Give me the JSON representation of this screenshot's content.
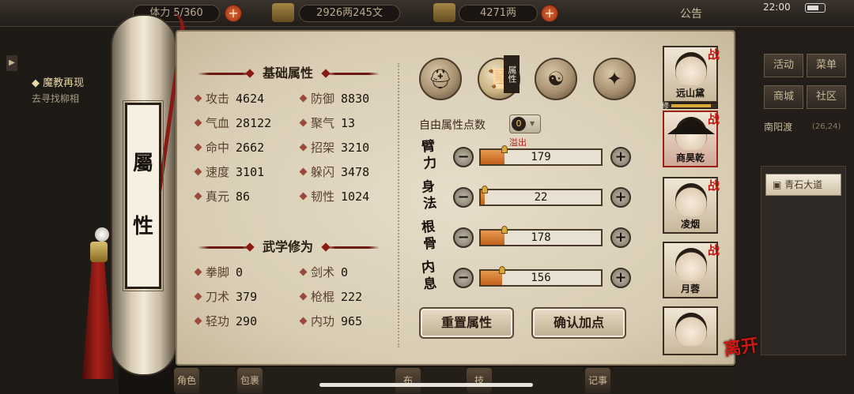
{
  "topbar": {
    "stamina": "5/360",
    "stamina_label": "体力",
    "silver": "2926两245文",
    "gold": "4271两",
    "announcement": "公告",
    "time": "22:00"
  },
  "quest": {
    "title": "魔教再现",
    "subtitle": "去寻找柳相"
  },
  "scroll": {
    "label_top": "屬",
    "label_bottom": "性"
  },
  "basic": {
    "title": "基础属性",
    "stats": [
      {
        "name": "攻击",
        "value": "4624"
      },
      {
        "name": "防御",
        "value": "8830"
      },
      {
        "name": "气血",
        "value": "28122"
      },
      {
        "name": "聚气",
        "value": "13"
      },
      {
        "name": "命中",
        "value": "2662"
      },
      {
        "name": "招架",
        "value": "3210"
      },
      {
        "name": "速度",
        "value": "3101"
      },
      {
        "name": "躲闪",
        "value": "3478"
      },
      {
        "name": "真元",
        "value": "86"
      },
      {
        "name": "韧性",
        "value": "1024"
      }
    ]
  },
  "martial": {
    "title": "武学修为",
    "stats": [
      {
        "name": "拳脚",
        "value": "0"
      },
      {
        "name": "剑术",
        "value": "0"
      },
      {
        "name": "刀术",
        "value": "379"
      },
      {
        "name": "枪棍",
        "value": "222"
      },
      {
        "name": "轻功",
        "value": "290"
      },
      {
        "name": "内功",
        "value": "965"
      }
    ]
  },
  "tabs": {
    "badge": "属性",
    "icons": [
      "hat-character-icon",
      "scroll-attributes-icon",
      "bagua-icon",
      "meridian-figure-icon"
    ]
  },
  "allocation": {
    "free_label": "自由属性点数",
    "free_points": "0",
    "overflow_label": "溢出",
    "attributes": [
      {
        "name_top": "臂",
        "name_bottom": "力",
        "value": "179",
        "fill": 0.2
      },
      {
        "name_top": "身",
        "name_bottom": "法",
        "value": "22",
        "fill": 0.03
      },
      {
        "name_top": "根",
        "name_bottom": "骨",
        "value": "178",
        "fill": 0.2
      },
      {
        "name_top": "内",
        "name_bottom": "息",
        "value": "156",
        "fill": 0.18
      }
    ],
    "minus": "−",
    "plus": "+"
  },
  "buttons": {
    "reset": "重置属性",
    "confirm": "确认加点"
  },
  "party": {
    "battle_mark": "战",
    "level_tag": "修",
    "members": [
      {
        "name": "远山黛"
      },
      {
        "name": "商昊乾"
      },
      {
        "name": "凌烟"
      },
      {
        "name": "月蓉"
      },
      {
        "name": ""
      }
    ]
  },
  "leave": "离开",
  "right_menu": {
    "activity": "活动",
    "menu": "菜单",
    "shop": "商城",
    "community": "社区",
    "location": "南阳渡",
    "coords": "(26,24)",
    "road": "青石大道"
  },
  "bottom": {
    "items": [
      "角色",
      "包裹",
      "布",
      "技",
      "记事"
    ]
  }
}
